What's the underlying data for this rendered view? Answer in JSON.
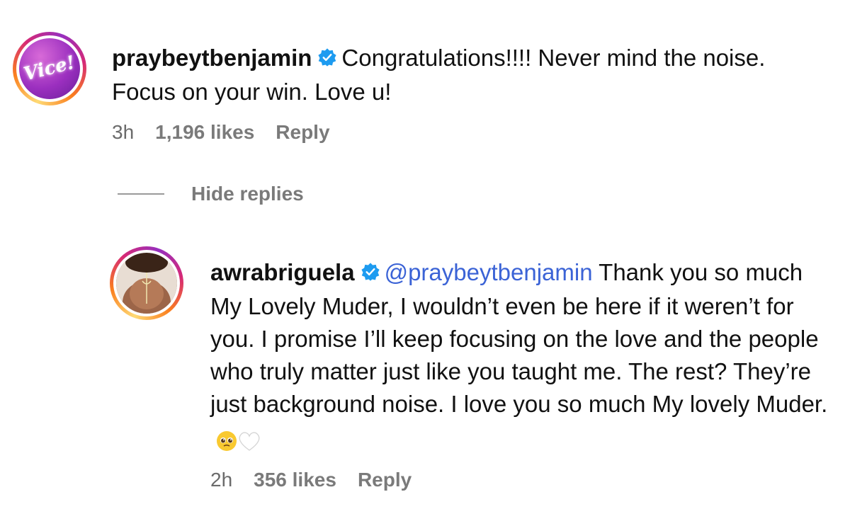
{
  "comments": [
    {
      "username": "praybeytbenjamin",
      "verified": true,
      "avatar_text": "Vice!",
      "text": "Congratulations!!!! Never mind the noise. Focus on your win. Love u!",
      "time": "3h",
      "likes": "1,196 likes",
      "reply_label": "Reply"
    }
  ],
  "hide_replies_label": "Hide replies",
  "reply": {
    "username": "awrabriguela",
    "verified": true,
    "mention": "@praybeytbenjamin",
    "text": "Thank you so much My Lovely Muder, I wouldn’t even be here if it weren’t for you. I promise I’ll keep focusing on the love and the people who truly matter just like you taught me. The rest? They’re just background noise. I love you so much My lovely Muder.",
    "emojis": [
      "pleading-face-emoji",
      "white-heart-emoji"
    ],
    "time": "2h",
    "likes": "356 likes",
    "reply_label": "Reply"
  },
  "colors": {
    "verified_badge": "#1d9bf0",
    "mention": "#3b63d6",
    "meta_text": "#7a7a7a"
  }
}
